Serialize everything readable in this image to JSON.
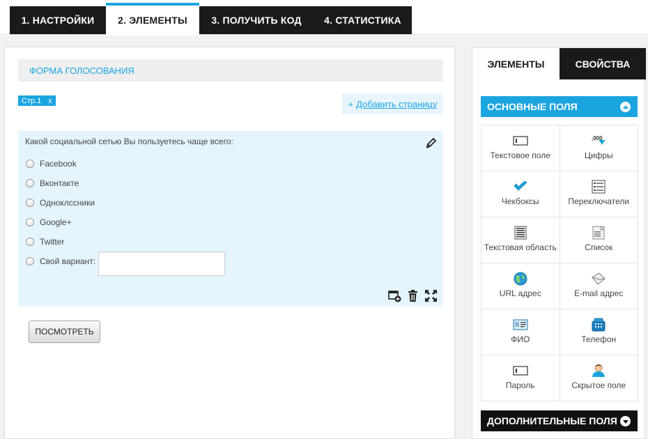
{
  "tabs": [
    {
      "label": "1. НАСТРОЙКИ"
    },
    {
      "label": "2. ЭЛЕМЕНТЫ"
    },
    {
      "label": "3. ПОЛУЧИТЬ КОД"
    },
    {
      "label": "4. СТАТИСТИКА"
    }
  ],
  "form": {
    "title": "ФОРМА ГОЛОСОВАНИЯ",
    "page_chip": "Стр.1",
    "page_chip_close": "x",
    "add_page_plus": "+",
    "add_page_label": "Добавить страницу"
  },
  "question": {
    "text": "Какой социальной сетью Вы пользуетесь чаще всего:",
    "options": [
      "Facebook",
      "Вконтакте",
      "Одноклссники",
      "Google+",
      "Twitter"
    ],
    "other_label": "Свой вариант:",
    "other_value": ""
  },
  "preview_button": "ПОСМОТРЕТЬ",
  "right_panel": {
    "tabs": [
      "ЭЛЕМЕНТЫ",
      "СВОЙСТВА"
    ],
    "basic_header": "ОСНОВНЫЕ ПОЛЯ",
    "extra_header": "ДОПОЛНИТЕЛЬНЫЕ ПОЛЯ",
    "fields": [
      {
        "label": "Текстовое поле",
        "icon": "text-field-icon"
      },
      {
        "label": "Цифры",
        "icon": "numbers-icon"
      },
      {
        "label": "Чекбоксы",
        "icon": "checkbox-icon"
      },
      {
        "label": "Переключатели",
        "icon": "radio-list-icon"
      },
      {
        "label": "Текстовая область",
        "icon": "textarea-icon"
      },
      {
        "label": "Список",
        "icon": "list-icon"
      },
      {
        "label": "URL адрес",
        "icon": "globe-icon"
      },
      {
        "label": "E-mail адрес",
        "icon": "envelope-icon"
      },
      {
        "label": "ФИО",
        "icon": "id-card-icon"
      },
      {
        "label": "Телефон",
        "icon": "phone-icon"
      },
      {
        "label": "Пароль",
        "icon": "password-icon"
      },
      {
        "label": "Скрытое поле",
        "icon": "hidden-user-icon"
      }
    ]
  },
  "colors": {
    "accent": "#1ba5e0",
    "dark": "#1a1a1a",
    "question_bg": "#e5f5fd"
  }
}
